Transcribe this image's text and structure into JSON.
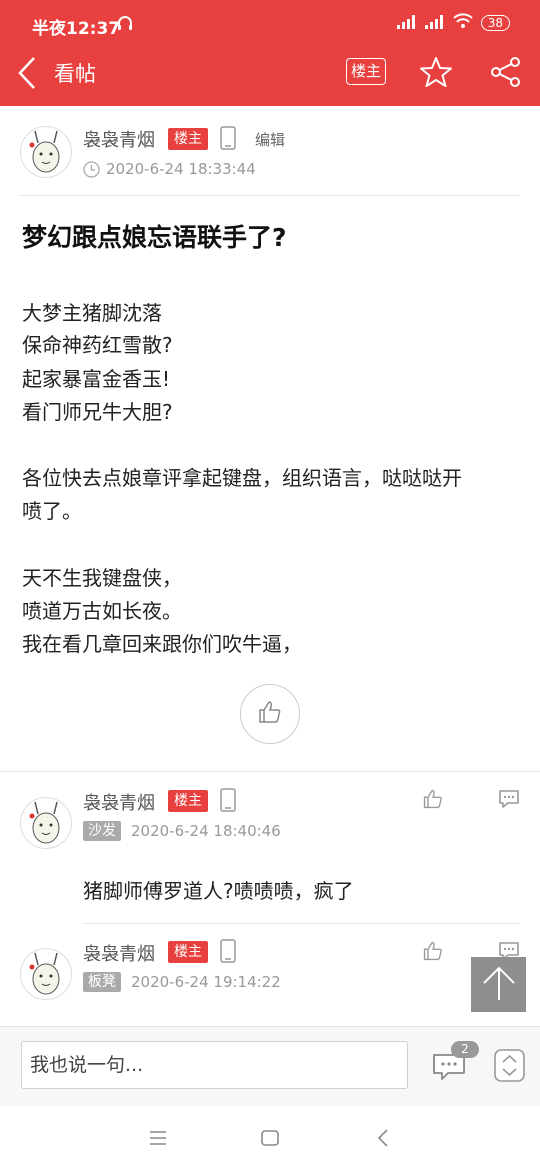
{
  "status_bar": {
    "time": "半夜12:37",
    "battery": "38"
  },
  "nav": {
    "back_icon": "chevron-left-icon",
    "title": "看帖",
    "owner_only_label": "楼主",
    "star_icon": "star-icon",
    "share_icon": "share-icon"
  },
  "post": {
    "author": "袅袅青烟",
    "owner_badge": "楼主",
    "edit_label": "编辑",
    "time": "2020-6-24 18:33:44",
    "title": "梦幻跟点娘忘语联手了?",
    "lines": [
      "大梦主猪脚沈落",
      "保命神药红雪散?",
      "起家暴富金香玉!",
      "看门师兄牛大胆?",
      "各位快去点娘章评拿起键盘，组织语言，哒哒哒开",
      "喷了。",
      "天不生我键盘侠，",
      "喷道万古如长夜。",
      "我在看几章回来跟你们吹牛逼，"
    ]
  },
  "replies": [
    {
      "author": "袅袅青烟",
      "owner_badge": "楼主",
      "floor": "沙发",
      "time": "2020-6-24 18:40:46",
      "text": "猪脚师傅罗道人?啧啧啧，疯了"
    },
    {
      "author": "袅袅青烟",
      "owner_badge": "楼主",
      "floor": "板凳",
      "time": "2020-6-24 19:14:22",
      "text": ""
    }
  ],
  "bottom_bar": {
    "input_placeholder": "我也说一句...",
    "comment_count": "2"
  },
  "colors": {
    "accent": "#e8403e",
    "floor_badge": "#aaaaaa"
  }
}
